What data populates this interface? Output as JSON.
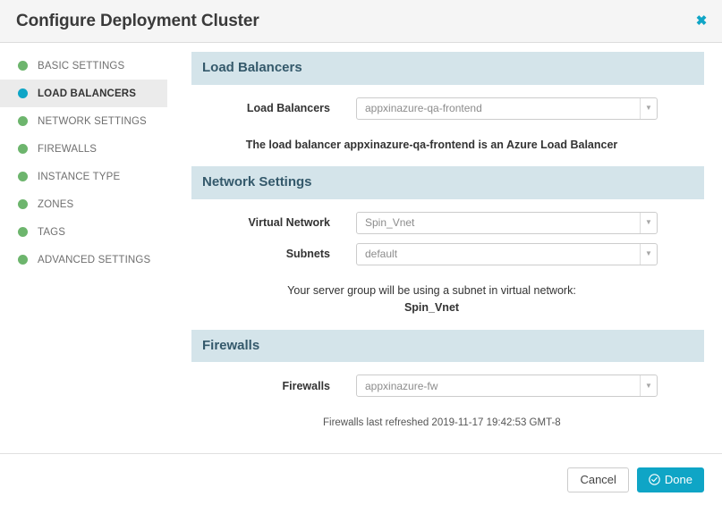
{
  "header": {
    "title": "Configure Deployment Cluster",
    "close_icon": "close-icon",
    "close_label": "✖"
  },
  "sidebar": {
    "items": [
      {
        "label": "BASIC SETTINGS",
        "status": "green",
        "active": false
      },
      {
        "label": "LOAD BALANCERS",
        "status": "blue",
        "active": true
      },
      {
        "label": "NETWORK SETTINGS",
        "status": "green",
        "active": false
      },
      {
        "label": "FIREWALLS",
        "status": "green",
        "active": false
      },
      {
        "label": "INSTANCE TYPE",
        "status": "green",
        "active": false
      },
      {
        "label": "ZONES",
        "status": "green",
        "active": false
      },
      {
        "label": "TAGS",
        "status": "green",
        "active": false
      },
      {
        "label": "ADVANCED SETTINGS",
        "status": "green",
        "active": false
      }
    ]
  },
  "sections": {
    "load_balancers": {
      "title": "Load Balancers",
      "field_label": "Load Balancers",
      "field_value": "appxinazure-qa-frontend",
      "helper": "The load balancer appxinazure-qa-frontend is an Azure Load Balancer"
    },
    "network_settings": {
      "title": "Network Settings",
      "vnet_label": "Virtual Network",
      "vnet_value": "Spin_Vnet",
      "subnets_label": "Subnets",
      "subnets_value": "default",
      "helper_line1": "Your server group will be using a subnet in virtual network:",
      "helper_line2": "Spin_Vnet"
    },
    "firewalls": {
      "title": "Firewalls",
      "field_label": "Firewalls",
      "field_value": "appxinazure-fw",
      "helper": "Firewalls last refreshed 2019-11-17 19:42:53 GMT-8"
    }
  },
  "footer": {
    "cancel_label": "Cancel",
    "done_label": "Done",
    "done_icon": "check-circle-icon"
  },
  "colors": {
    "accent": "#0fa5c6",
    "status_green": "#6db56d",
    "status_blue": "#0fa5c6",
    "section_header_bg": "#d4e4ea",
    "section_header_text": "#34596b"
  },
  "caret_glyph": "▼"
}
